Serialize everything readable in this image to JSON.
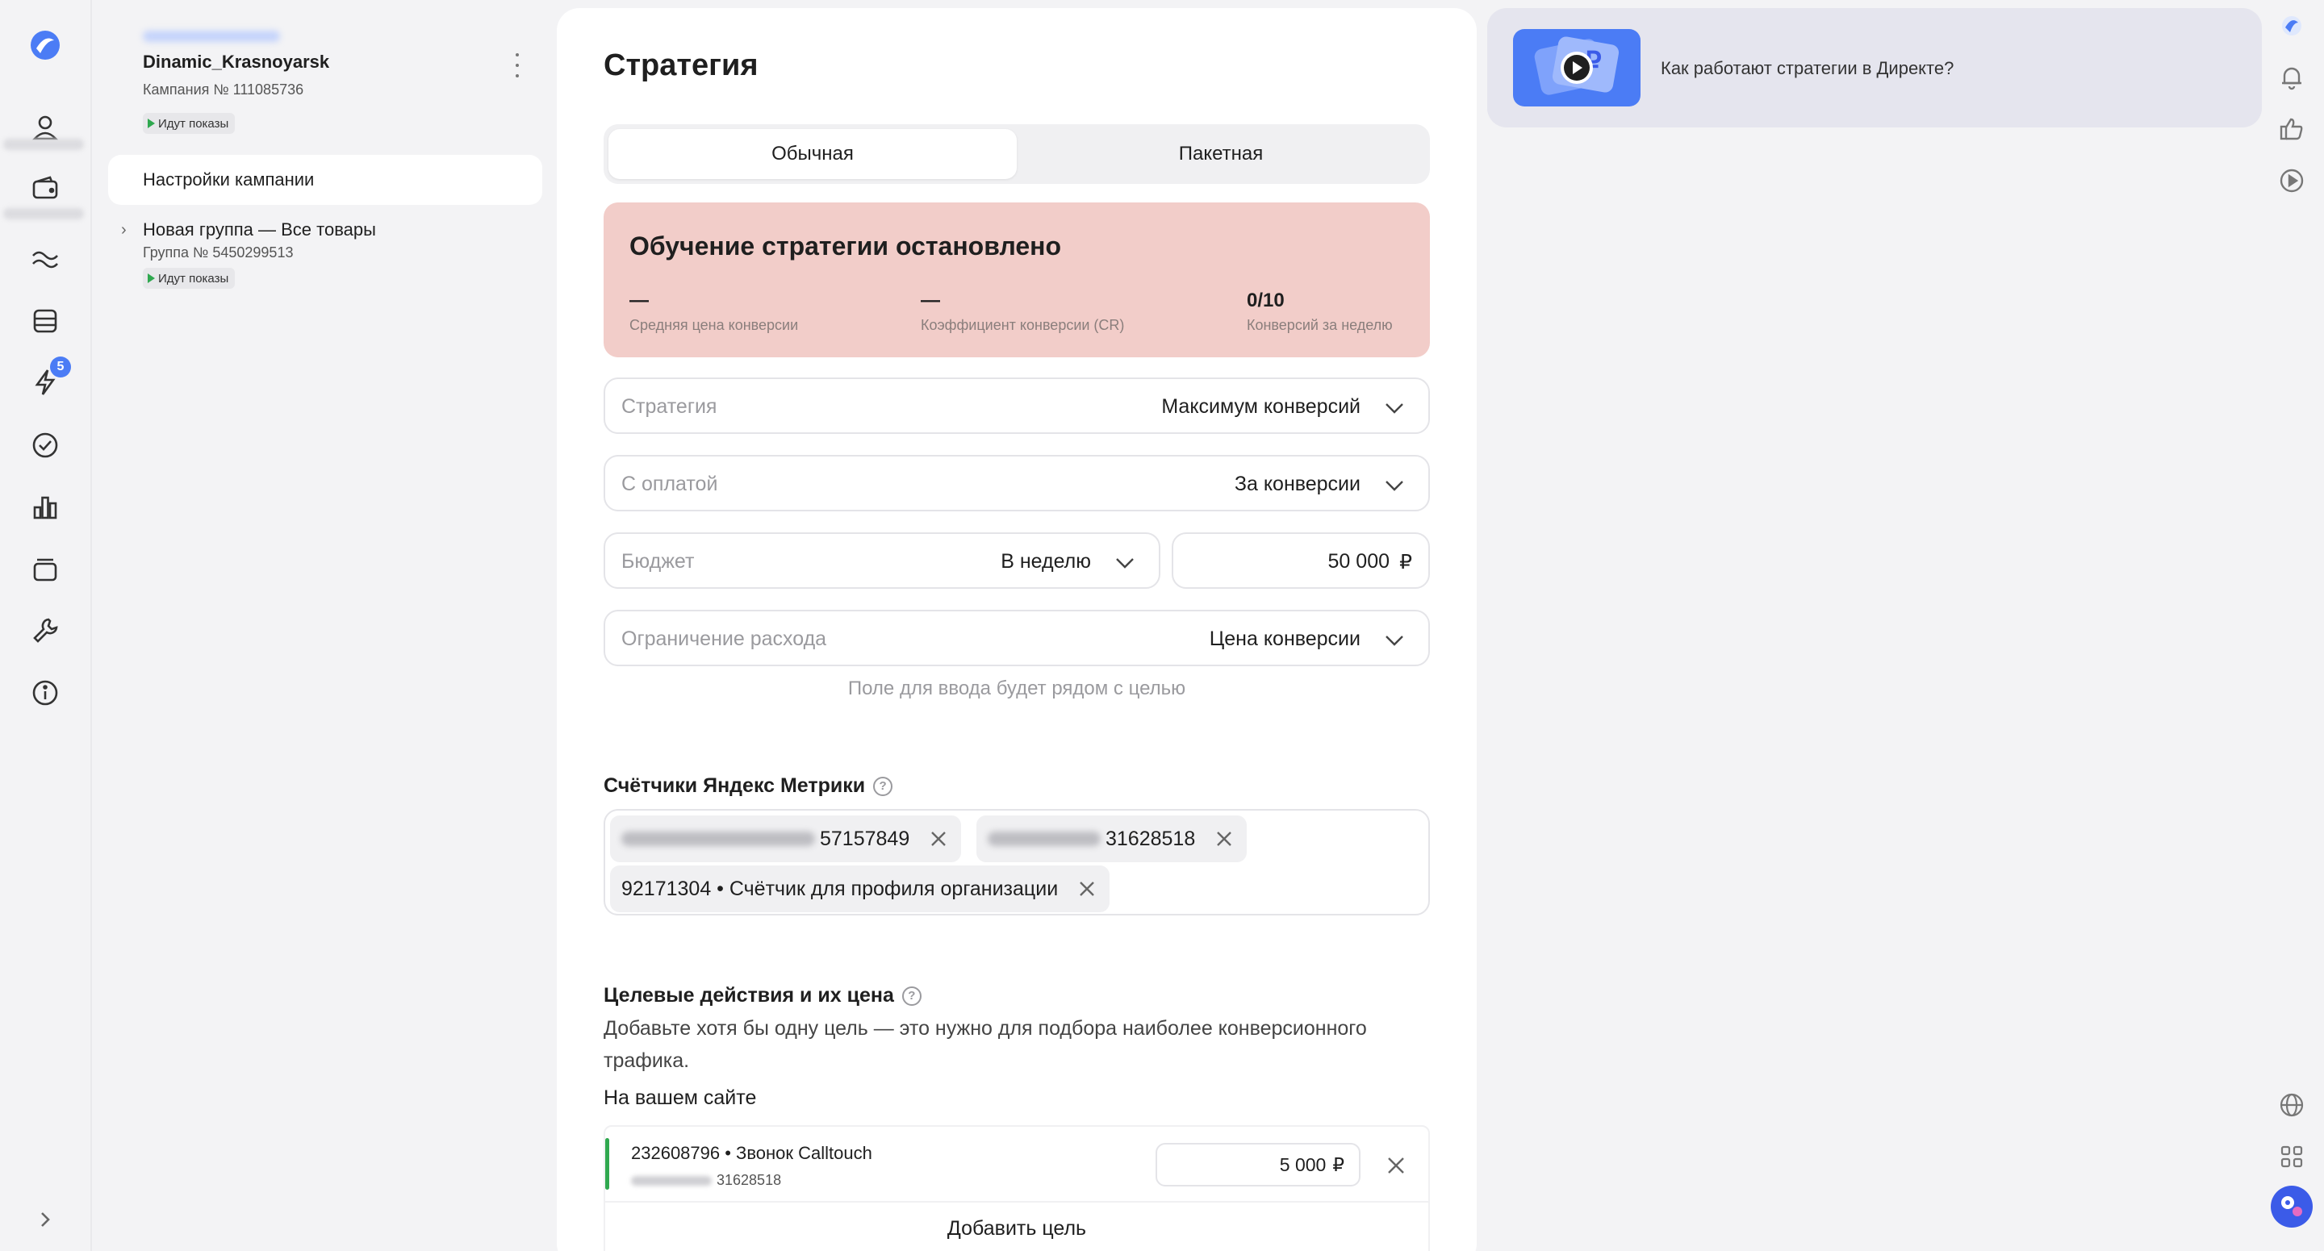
{
  "colors": {
    "accent": "#4b7cf5",
    "alert_bg": "#f2cdc9",
    "status_green": "#2fa84f"
  },
  "rail": {
    "badge_count": "5",
    "icons": [
      "logo-icon",
      "profile-icon",
      "wallet-icon",
      "wave-icon",
      "campaigns-icon",
      "lightning-icon",
      "check-circle-icon",
      "bar-chart-icon",
      "library-icon",
      "wrench-icon",
      "info-icon",
      "expand-icon"
    ]
  },
  "campaign": {
    "name": "Dinamic_Krasnoyarsk",
    "number": "Кампания № 111085736",
    "status": "Идут показы"
  },
  "tree": {
    "selected_label": "Настройки кампании",
    "group_name": "Новая группа — Все товары",
    "group_number": "Группа № 5450299513",
    "group_status": "Идут показы"
  },
  "main": {
    "title": "Стратегия",
    "tabs": [
      {
        "label": "Обычная",
        "active": true
      },
      {
        "label": "Пакетная",
        "active": false
      }
    ],
    "alert": {
      "title": "Обучение стратегии остановлено",
      "metrics": [
        {
          "value": "—",
          "label": "Средняя цена конверсии"
        },
        {
          "value": "—",
          "label": "Коэффициент конверсии (CR)"
        },
        {
          "value": "0/10",
          "label": "Конверсий за неделю"
        }
      ]
    },
    "strategy": {
      "label": "Стратегия",
      "value": "Максимум конверсий"
    },
    "payment": {
      "label": "С оплатой",
      "value": "За конверсии"
    },
    "budget": {
      "label": "Бюджет",
      "period": "В неделю",
      "amount": "50 000",
      "currency": "₽"
    },
    "limit": {
      "label": "Ограничение расхода",
      "value": "Цена конверсии"
    },
    "hint": "Поле для ввода будет рядом с целью",
    "counters": {
      "title": "Счётчики Яндекс Метрики",
      "chips": [
        {
          "text": "57157849"
        },
        {
          "text": "31628518"
        },
        {
          "text": "92171304 • Счётчик для профиля организации"
        }
      ]
    },
    "goals": {
      "title": "Целевые действия и их цена",
      "description": "Добавьте хотя бы одну цель — это нужно для подбора наиболее конверсионного трафика.",
      "site_label": "На вашем сайте",
      "items": [
        {
          "name": "232608796 • Звонок Calltouch",
          "counter": "31628518",
          "price": "5 000",
          "currency": "₽"
        }
      ],
      "add_label": "Добавить цель"
    }
  },
  "help": {
    "text": "Как работают стратегии в Директе?"
  }
}
